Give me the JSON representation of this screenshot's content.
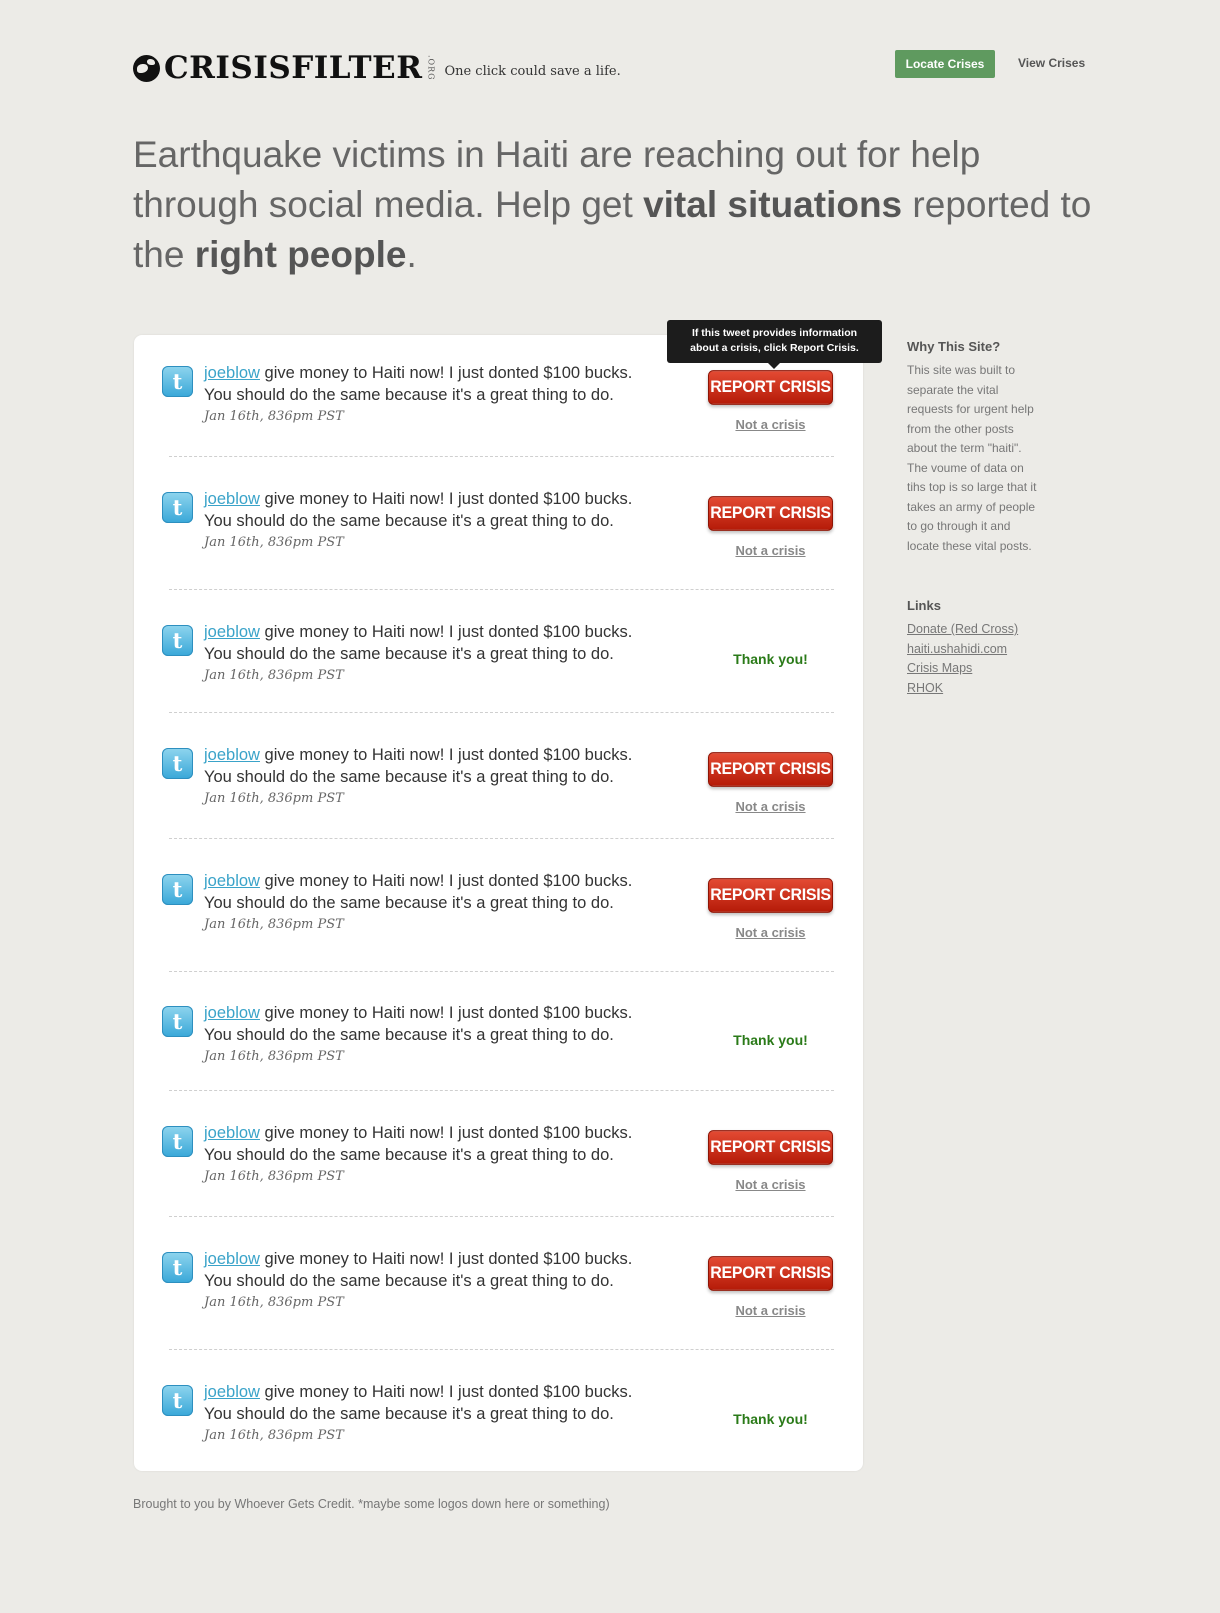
{
  "header": {
    "logo_text": "CRISISFILTER",
    "logo_suffix": ".ORG",
    "tagline": "One click could save a life.",
    "nav": {
      "locate_label": "Locate Crises",
      "view_label": "View Crises"
    }
  },
  "intro": {
    "part1": "Earthquake victims in Haiti are reaching out for help through social media. Help get ",
    "bold1": "vital situations",
    "part2": " reported to the ",
    "bold2": "right people",
    "part3": "."
  },
  "tooltip": {
    "line1": "If this tweet provides information",
    "line2": "about a crisis, click Report Crisis."
  },
  "actions": {
    "report_label": "Report Crisis",
    "not_crisis_label": "Not a crisis",
    "thanks_label": "Thank you!"
  },
  "tweets": [
    {
      "user": "joeblow",
      "text": " give money to Haiti now! I just donted $100 bucks. You should do the same because it's a great thing to do.",
      "date": "Jan 16th, 836pm PST",
      "state": "open"
    },
    {
      "user": "joeblow",
      "text": " give money to Haiti now! I just donted $100 bucks. You should do the same because it's a great thing to do.",
      "date": "Jan 16th, 836pm PST",
      "state": "open"
    },
    {
      "user": "joeblow",
      "text": " give money to Haiti now! I just donted $100 bucks. You should do the same because it's a great thing to do.",
      "date": "Jan 16th, 836pm PST",
      "state": "thanked"
    },
    {
      "user": "joeblow",
      "text": " give money to Haiti now! I just donted $100 bucks. You should do the same because it's a great thing to do.",
      "date": "Jan 16th, 836pm PST",
      "state": "open"
    },
    {
      "user": "joeblow",
      "text": " give money to Haiti now! I just donted $100 bucks. You should do the same because it's a great thing to do.",
      "date": "Jan 16th, 836pm PST",
      "state": "open"
    },
    {
      "user": "joeblow",
      "text": " give money to Haiti now! I just donted $100 bucks. You should do the same because it's a great thing to do.",
      "date": "Jan 16th, 836pm PST",
      "state": "thanked"
    },
    {
      "user": "joeblow",
      "text": " give money to Haiti now! I just donted $100 bucks. You should do the same because it's a great thing to do.",
      "date": "Jan 16th, 836pm PST",
      "state": "open"
    },
    {
      "user": "joeblow",
      "text": " give money to Haiti now! I just donted $100 bucks. You should do the same because it's a great thing to do.",
      "date": "Jan 16th, 836pm PST",
      "state": "open"
    },
    {
      "user": "joeblow",
      "text": " give money to Haiti now! I just donted $100 bucks. You should do the same because it's a great thing to do.",
      "date": "Jan 16th, 836pm PST",
      "state": "thanked"
    }
  ],
  "sidebar": {
    "why_title": "Why This Site?",
    "why_text": "This site was built to separate the vital requests for urgent help from the other posts about the term \"haiti\". The voume of data on tihs top is so large that it takes an army of people to go through it and locate these vital posts.",
    "links_title": "Links",
    "links": [
      "Donate (Red Cross)",
      "haiti.ushahidi.com",
      "Crisis Maps",
      "RHOK"
    ]
  },
  "footer": {
    "text": "Brought to you by Whoever Gets Credit. *maybe some logos down here or something)"
  },
  "colors": {
    "background": "#ecebe7",
    "accent_green": "#5f9a5f",
    "report_red": "#c8280f",
    "link_blue": "#3aa3c9",
    "thanks_green": "#2a7a18"
  },
  "icons": {
    "tweet": "twitter-bird-icon",
    "logo": "globe-icon"
  }
}
